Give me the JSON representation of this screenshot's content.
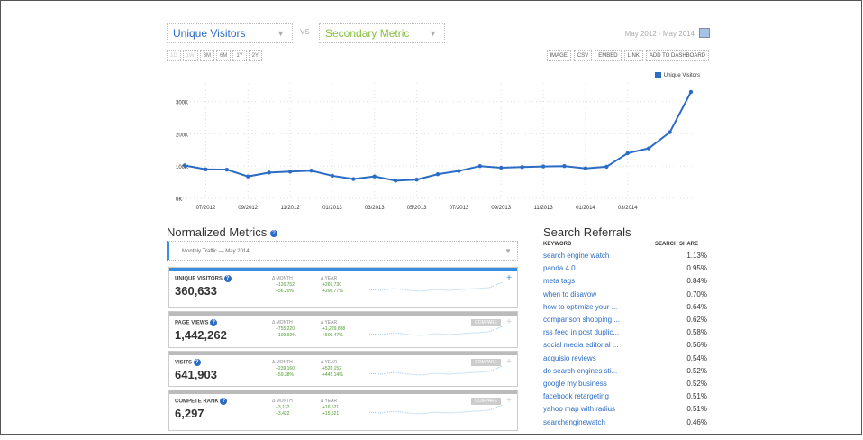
{
  "selectors": {
    "primary": "Unique Visitors",
    "vs": "VS",
    "secondary": "Secondary Metric"
  },
  "date_range": "May 2012 - May 2014",
  "range_buttons": [
    "1D",
    "1W",
    "3M",
    "6M",
    "1Y",
    "2Y"
  ],
  "toolbar": [
    "IMAGE",
    "CSV",
    "EMBED",
    "LINK",
    "ADD TO DASHBOARD"
  ],
  "colors": {
    "line": "#2b6cc4",
    "secondary": "#86c03c",
    "positive": "#4a9a2a"
  },
  "chart_data": {
    "type": "line",
    "legend": "Unique Visitors",
    "legend_position": "top-right",
    "y_ticks": [
      "0K",
      "100K",
      "200K",
      "300K"
    ],
    "ylim": [
      0,
      380000
    ],
    "x_ticks": [
      "07/2012",
      "09/2012",
      "11/2012",
      "01/2013",
      "03/2013",
      "05/2013",
      "07/2013",
      "09/2013",
      "11/2013",
      "01/2014",
      "03/2014"
    ],
    "series": [
      {
        "name": "Unique Visitors",
        "values": [
          102000,
          90000,
          89000,
          68000,
          80000,
          83000,
          86000,
          70000,
          60000,
          68000,
          55000,
          58000,
          75000,
          85000,
          100000,
          95000,
          97000,
          99000,
          100000,
          93000,
          98000,
          140000,
          155000,
          205000,
          330000
        ]
      }
    ],
    "grid": true
  },
  "normalized": {
    "title": "Normalized Metrics",
    "dropdown": "Monthly Traffic — May 2014",
    "cards": [
      {
        "label": "UNIQUE VISITORS",
        "value": "360,633",
        "month_h": "Δ MONTH",
        "year_h": "Δ YEAR",
        "m1": "+126,752",
        "m2": "+56.20%",
        "y1": "+269,730",
        "y2": "+296.77%",
        "compare": ""
      },
      {
        "label": "PAGE VIEWS",
        "value": "1,442,262",
        "month_h": "Δ MONTH",
        "year_h": "Δ YEAR",
        "m1": "+755,220",
        "m2": "+109.92%",
        "y1": "+1,229,838",
        "y2": "+509.47%",
        "compare": "COMPARE"
      },
      {
        "label": "VISITS",
        "value": "641,903",
        "month_h": "Δ MONTH",
        "year_h": "Δ YEAR",
        "m1": "+239,160",
        "m2": "+59.38%",
        "y1": "+526,152",
        "y2": "+445.14%",
        "compare": "COMPARE"
      },
      {
        "label": "COMPETE RANK",
        "value": "6,297",
        "month_h": "Δ MONTH",
        "year_h": "Δ YEAR",
        "m1": "+3,132",
        "m2": "+3,422",
        "y1": "+16,521",
        "y2": "+15,521",
        "compare": "COMPARE"
      }
    ]
  },
  "referrals": {
    "title": "Search Referrals",
    "col_keyword": "KEYWORD",
    "col_share": "SEARCH SHARE",
    "rows": [
      {
        "kw": "search engine watch",
        "pct": "1.13%"
      },
      {
        "kw": "panda 4.0",
        "pct": "0.95%"
      },
      {
        "kw": "meta tags",
        "pct": "0.84%"
      },
      {
        "kw": "when to disavow",
        "pct": "0.70%"
      },
      {
        "kw": "how to optimize your ...",
        "pct": "0.64%"
      },
      {
        "kw": "comparison shopping ...",
        "pct": "0.62%"
      },
      {
        "kw": "rss feed in post duplic...",
        "pct": "0.58%"
      },
      {
        "kw": "social media editorial ...",
        "pct": "0.56%"
      },
      {
        "kw": "acquisio reviews",
        "pct": "0.54%"
      },
      {
        "kw": "do search engines sti...",
        "pct": "0.52%"
      },
      {
        "kw": "google my business",
        "pct": "0.52%"
      },
      {
        "kw": "facebook retargeting",
        "pct": "0.51%"
      },
      {
        "kw": "yahoo map with radius",
        "pct": "0.51%"
      },
      {
        "kw": "searchenginewatch",
        "pct": "0.46%"
      }
    ]
  }
}
